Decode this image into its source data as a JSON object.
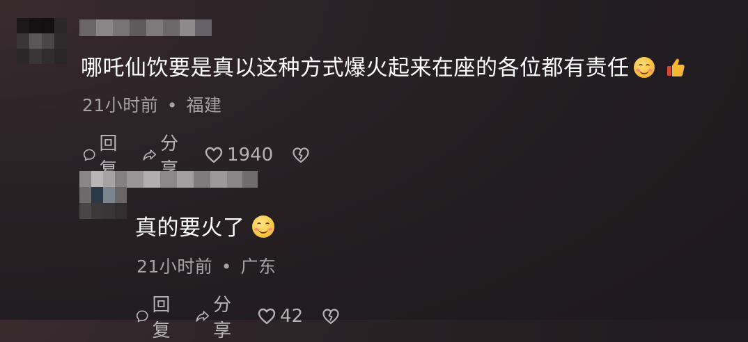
{
  "comments": [
    {
      "text": "哪吒仙饮要是真以这种方式爆火起来在座的各位都有责任",
      "time": "21小时前",
      "separator": "•",
      "location": "福建",
      "reply_label": "回复",
      "share_label": "分享",
      "like_count": "1940",
      "emojis": [
        "grin-emoji",
        "thumbs-up-emoji"
      ]
    },
    {
      "text": "真的要火了",
      "time": "21小时前",
      "separator": "•",
      "location": "广东",
      "reply_label": "回复",
      "share_label": "分享",
      "like_count": "42",
      "emojis": [
        "smile-emoji"
      ]
    }
  ],
  "colors": {
    "background": "#241e21",
    "text": "#ffffff",
    "meta": "#a7a3a5",
    "action": "#b7b3b5"
  }
}
